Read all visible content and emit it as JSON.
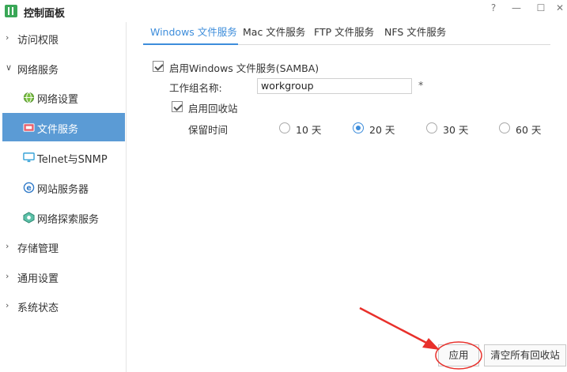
{
  "window": {
    "title": "控制面板",
    "help_glyph": "?",
    "minimize_glyph": "—",
    "maximize_glyph": "☐",
    "close_glyph": "✕"
  },
  "sidebar": {
    "groups": [
      {
        "label": "访问权限",
        "expanded": false,
        "chevron": "›"
      },
      {
        "label": "网络服务",
        "expanded": true,
        "chevron": "∨"
      },
      {
        "label": "存储管理",
        "expanded": false,
        "chevron": "›"
      },
      {
        "label": "通用设置",
        "expanded": false,
        "chevron": "›"
      },
      {
        "label": "系统状态",
        "expanded": false,
        "chevron": "›"
      }
    ],
    "items": [
      {
        "label": "网络设置",
        "icon": "globe-icon"
      },
      {
        "label": "文件服务",
        "icon": "file-service-icon",
        "active": true
      },
      {
        "label": "Telnet与SNMP",
        "icon": "monitor-icon"
      },
      {
        "label": "网站服务器",
        "icon": "ie-icon"
      },
      {
        "label": "网络探索服务",
        "icon": "network-discovery-icon"
      }
    ],
    "active_color": "#5b9bd5"
  },
  "tabs": [
    {
      "label": "Windows 文件服务",
      "active": true
    },
    {
      "label": "Mac 文件服务"
    },
    {
      "label": "FTP 文件服务"
    },
    {
      "label": "NFS 文件服务"
    }
  ],
  "form": {
    "enable_samba_label": "启用Windows 文件服务(SAMBA)",
    "enable_samba_checked": true,
    "workgroup_label": "工作组名称:",
    "workgroup_value": "workgroup",
    "required_mark": "*",
    "recycle_label": "启用回收站",
    "recycle_checked": true,
    "retention_label": "保留时间",
    "retention_options": [
      "10 天",
      "20 天",
      "30 天",
      "60 天"
    ],
    "retention_selected": "20 天"
  },
  "buttons": {
    "apply": "应用",
    "clear_recycle": "清空所有回收站"
  },
  "colors": {
    "accent": "#3d8ddb",
    "annotation": "#e8302b"
  }
}
